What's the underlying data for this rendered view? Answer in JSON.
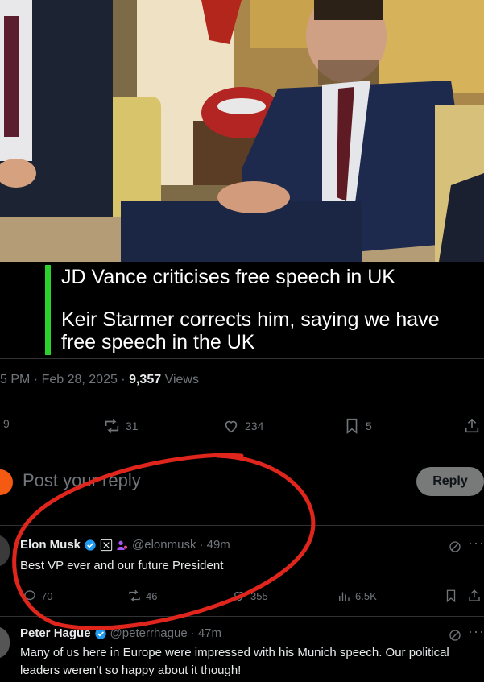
{
  "video": {
    "caption_line1": "JD Vance criticises free speech in UK",
    "caption_line2": "Keir Starmer corrects him, saying we have free speech in the UK"
  },
  "post_meta": {
    "time_date": "5 PM · Feb 28, 2025 · ",
    "views_count": "9,357",
    "views_label": " Views"
  },
  "actions": {
    "replies": "9",
    "reposts": "31",
    "likes": "234",
    "bookmarks": "5"
  },
  "composer": {
    "placeholder": "Post your reply",
    "reply_button": "Reply"
  },
  "replies": [
    {
      "name": "Elon Musk",
      "handle": "@elonmusk",
      "time": "· 49m",
      "text": "Best VP ever and our future President",
      "stats": {
        "replies": "70",
        "reposts": "46",
        "likes": "355",
        "views": "6.5K"
      }
    },
    {
      "name": "Peter Hague",
      "handle": "@peterrhague",
      "time": "· 47m",
      "text": "Many of us here in Europe were impressed with his Munich speech. Our political leaders weren’t so happy about it though!"
    }
  ],
  "colors": {
    "accent_green": "#2dd12d",
    "verified_blue": "#1d9bf0",
    "annotation_red": "#e0261c",
    "muted": "#71767b"
  }
}
